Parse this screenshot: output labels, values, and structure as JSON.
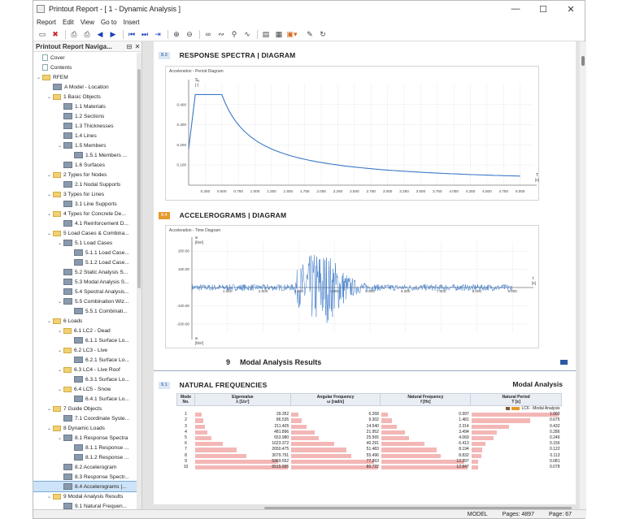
{
  "window": {
    "title": "Printout Report - [ 1 - Dynamic Analysis ]"
  },
  "menu": [
    "Report",
    "Edit",
    "View",
    "Go to",
    "Insert"
  ],
  "toolbar_icons": [
    "new-page-icon",
    "delete-page-icon",
    "print-icon",
    "print-options-icon",
    "prev-page-icon",
    "next-page-icon",
    "first-page-icon",
    "last-page-icon",
    "goto-page-icon",
    "zoom-in-icon",
    "zoom-out-icon",
    "link-icon",
    "unlink-icon",
    "find-icon",
    "unlink2-icon",
    "export-icon",
    "layout-icon",
    "settings-icon",
    "edit-icon",
    "refresh-icon"
  ],
  "nav": {
    "title": "Printout Report Naviga...",
    "items": [
      {
        "label": "Cover",
        "level": 0,
        "icon": "doc",
        "arrow": ""
      },
      {
        "label": "Contents",
        "level": 0,
        "icon": "doc",
        "arrow": ""
      },
      {
        "label": "RFEM",
        "level": 0,
        "icon": "folder",
        "arrow": "v"
      },
      {
        "label": "A Model - Location",
        "level": 1,
        "icon": "page",
        "arrow": ""
      },
      {
        "label": "1 Basic Objects",
        "level": 1,
        "icon": "folder",
        "arrow": "v"
      },
      {
        "label": "1.1 Materials",
        "level": 2,
        "icon": "page",
        "arrow": ""
      },
      {
        "label": "1.2 Sections",
        "level": 2,
        "icon": "page",
        "arrow": ""
      },
      {
        "label": "1.3 Thicknesses",
        "level": 2,
        "icon": "page",
        "arrow": ""
      },
      {
        "label": "1.4 Lines",
        "level": 2,
        "icon": "page",
        "arrow": ""
      },
      {
        "label": "1.5 Members",
        "level": 2,
        "icon": "page",
        "arrow": "v"
      },
      {
        "label": "1.5.1 Members ...",
        "level": 3,
        "icon": "page",
        "arrow": ""
      },
      {
        "label": "1.6 Surfaces",
        "level": 2,
        "icon": "page",
        "arrow": ""
      },
      {
        "label": "2 Types for Nodes",
        "level": 1,
        "icon": "folder",
        "arrow": "v"
      },
      {
        "label": "2.1 Nodal Supports",
        "level": 2,
        "icon": "page",
        "arrow": ""
      },
      {
        "label": "3 Types for Lines",
        "level": 1,
        "icon": "folder",
        "arrow": "v"
      },
      {
        "label": "3.1 Line Supports",
        "level": 2,
        "icon": "page",
        "arrow": ""
      },
      {
        "label": "4 Types for Concrete De...",
        "level": 1,
        "icon": "folder",
        "arrow": "v"
      },
      {
        "label": "4.1 Reinforcement D...",
        "level": 2,
        "icon": "page",
        "arrow": ""
      },
      {
        "label": "5 Load Cases & Combina...",
        "level": 1,
        "icon": "folder",
        "arrow": "v"
      },
      {
        "label": "5.1 Load Cases",
        "level": 2,
        "icon": "page",
        "arrow": "v"
      },
      {
        "label": "5.1.1 Load Case...",
        "level": 3,
        "icon": "page",
        "arrow": ""
      },
      {
        "label": "5.1.2 Load Case...",
        "level": 3,
        "icon": "page",
        "arrow": ""
      },
      {
        "label": "5.2 Static Analysis S...",
        "level": 2,
        "icon": "page",
        "arrow": ""
      },
      {
        "label": "5.3 Modal Analysis S...",
        "level": 2,
        "icon": "page",
        "arrow": ""
      },
      {
        "label": "5.4 Spectral Analysis...",
        "level": 2,
        "icon": "page",
        "arrow": ""
      },
      {
        "label": "5.5 Combination Wiz...",
        "level": 2,
        "icon": "page",
        "arrow": "v"
      },
      {
        "label": "5.5.1 Combinati...",
        "level": 3,
        "icon": "page",
        "arrow": ""
      },
      {
        "label": "6 Loads",
        "level": 1,
        "icon": "folder",
        "arrow": "v"
      },
      {
        "label": "6.1 LC2 - Dead",
        "level": 2,
        "icon": "folder",
        "arrow": "v"
      },
      {
        "label": "6.1.1 Surface Lo...",
        "level": 3,
        "icon": "page",
        "arrow": ""
      },
      {
        "label": "6.2 LC3 - Live",
        "level": 2,
        "icon": "folder",
        "arrow": "v"
      },
      {
        "label": "6.2.1 Surface Lo...",
        "level": 3,
        "icon": "page",
        "arrow": ""
      },
      {
        "label": "6.3 LC4 - Live Roof",
        "level": 2,
        "icon": "folder",
        "arrow": "v"
      },
      {
        "label": "6.3.1 Surface Lo...",
        "level": 3,
        "icon": "page",
        "arrow": ""
      },
      {
        "label": "6.4 LC5 - Snow",
        "level": 2,
        "icon": "folder",
        "arrow": "v"
      },
      {
        "label": "6.4.1 Surface Lo...",
        "level": 3,
        "icon": "page",
        "arrow": ""
      },
      {
        "label": "7 Guide Objects",
        "level": 1,
        "icon": "folder",
        "arrow": "v"
      },
      {
        "label": "7.1 Coordinate Syste...",
        "level": 2,
        "icon": "page",
        "arrow": ""
      },
      {
        "label": "8 Dynamic Loads",
        "level": 1,
        "icon": "folder",
        "arrow": "v"
      },
      {
        "label": "8.1 Response Spectra",
        "level": 2,
        "icon": "page",
        "arrow": "v"
      },
      {
        "label": "8.1.1 Response ...",
        "level": 3,
        "icon": "page",
        "arrow": ""
      },
      {
        "label": "8.1.2 Response ...",
        "level": 3,
        "icon": "page",
        "arrow": ""
      },
      {
        "label": "8.2 Accelerogram",
        "level": 2,
        "icon": "page",
        "arrow": ""
      },
      {
        "label": "8.3 Response Spectr...",
        "level": 2,
        "icon": "page",
        "arrow": ""
      },
      {
        "label": "8.4 Accelerograms |...",
        "level": 2,
        "icon": "page",
        "arrow": "",
        "selected": true
      },
      {
        "label": "9 Modal Analysis Results",
        "level": 1,
        "icon": "folder",
        "arrow": "v"
      },
      {
        "label": "9.1 Natural Frequen...",
        "level": 2,
        "icon": "page",
        "arrow": ""
      }
    ]
  },
  "sections": {
    "s83": {
      "num": "8.3",
      "title": "RESPONSE SPECTRA | DIAGRAM"
    },
    "s84": {
      "num": "8.4",
      "title": "ACCELEROGRAMS | DIAGRAM"
    },
    "ch9": {
      "num": "9",
      "title": "Modal Analysis Results"
    },
    "s91": {
      "num": "9.1",
      "title": "NATURAL FREQUENCIES",
      "right": "Modal Analysis"
    }
  },
  "chart_data": [
    {
      "type": "line",
      "caption": "Acceleration - Period Diagram",
      "ylabel_top": "Sₐ",
      "ylabel_unit": "[-]",
      "xlabel_top": "T",
      "xlabel_unit": "[s]",
      "yticks": [
        "0.400",
        "0.300",
        "0.200",
        "0.100"
      ],
      "xticks": [
        "0.250",
        "0.500",
        "0.750",
        "1.000",
        "1.250",
        "1.500",
        "1.750",
        "2.000",
        "2.250",
        "2.500",
        "2.750",
        "3.000",
        "3.250",
        "3.500",
        "3.750",
        "4.000",
        "4.250",
        "4.500",
        "4.750",
        "5.000"
      ],
      "xlim": [
        0,
        5.2
      ],
      "ylim": [
        0,
        0.5
      ],
      "series": [
        {
          "x": [
            0,
            0.1,
            0.5,
            0.75,
            1,
            1.5,
            2,
            2.5,
            3,
            3.5,
            4,
            4.5,
            5
          ],
          "y": [
            0.18,
            0.45,
            0.45,
            0.3,
            0.225,
            0.15,
            0.1125,
            0.09,
            0.075,
            0.064,
            0.056,
            0.05,
            0.045
          ]
        }
      ],
      "color": "#3a78c8",
      "grid": true
    },
    {
      "type": "line",
      "caption": "Acceleration - Time Diagram",
      "ylabel_top": "a",
      "ylabel_unit": "[ft/s²]",
      "ylabel_bottom": "a",
      "ylabel_bottom_unit": "[ft/s²]",
      "xlabel_top": "t",
      "xlabel_unit": "[s]",
      "yticks": [
        "200.00",
        "100.00",
        "-100.00",
        "-200.00"
      ],
      "xticks": [
        "1.000",
        "2.000",
        "3.000",
        "4.000",
        "5.000",
        "6.000",
        "7.000",
        "8.000",
        "9.000"
      ],
      "xlim": [
        0,
        9.5
      ],
      "ylim": [
        -250,
        250
      ],
      "color": "#3a78c8",
      "grid": true
    }
  ],
  "table": {
    "headers": [
      [
        "Mode",
        "No."
      ],
      [
        "Eigenvalue",
        "λ [1/s²]"
      ],
      [
        "Angular Frequency",
        "ω [rad/s]"
      ],
      [
        "Natural Frequency",
        "f [Hz]"
      ],
      [
        "Natural Period",
        "T [s]"
      ]
    ],
    "lc_label": "LC6 - Modal Analysis",
    "rows": [
      [
        "1",
        "39.352",
        "6.268",
        "0.997",
        "1.003",
        0.07
      ],
      [
        "2",
        "86.535",
        "9.302",
        "1.481",
        "0.675",
        0.08
      ],
      [
        "3",
        "211.405",
        "14.540",
        "2.314",
        "0.432",
        0.1
      ],
      [
        "4",
        "481.896",
        "21.952",
        "3.494",
        "0.286",
        0.13
      ],
      [
        "5",
        "653.980",
        "25.565",
        "4.069",
        "0.246",
        0.17
      ],
      [
        "6",
        "1623.372",
        "40.291",
        "6.413",
        "0.156",
        0.3
      ],
      [
        "7",
        "2650.475",
        "51.483",
        "8.194",
        "0.122",
        0.45
      ],
      [
        "8",
        "3079.791",
        "55.496",
        "8.832",
        "0.113",
        0.55
      ],
      [
        "9",
        "5969.552",
        "77.263",
        "12.297",
        "0.081",
        0.9
      ],
      [
        "10",
        "6515.995",
        "80.722",
        "12.847",
        "0.078",
        1.0
      ]
    ],
    "period_fill": [
      1.0,
      0.67,
      0.43,
      0.29,
      0.25,
      0.16,
      0.12,
      0.11,
      0.08,
      0.08
    ],
    "ang_fill": [
      0.08,
      0.12,
      0.18,
      0.27,
      0.32,
      0.5,
      0.64,
      0.69,
      0.96,
      1.0
    ]
  },
  "status": {
    "mode": "MODEL",
    "pages": "Pages: 4897",
    "page": "Page: 67"
  }
}
